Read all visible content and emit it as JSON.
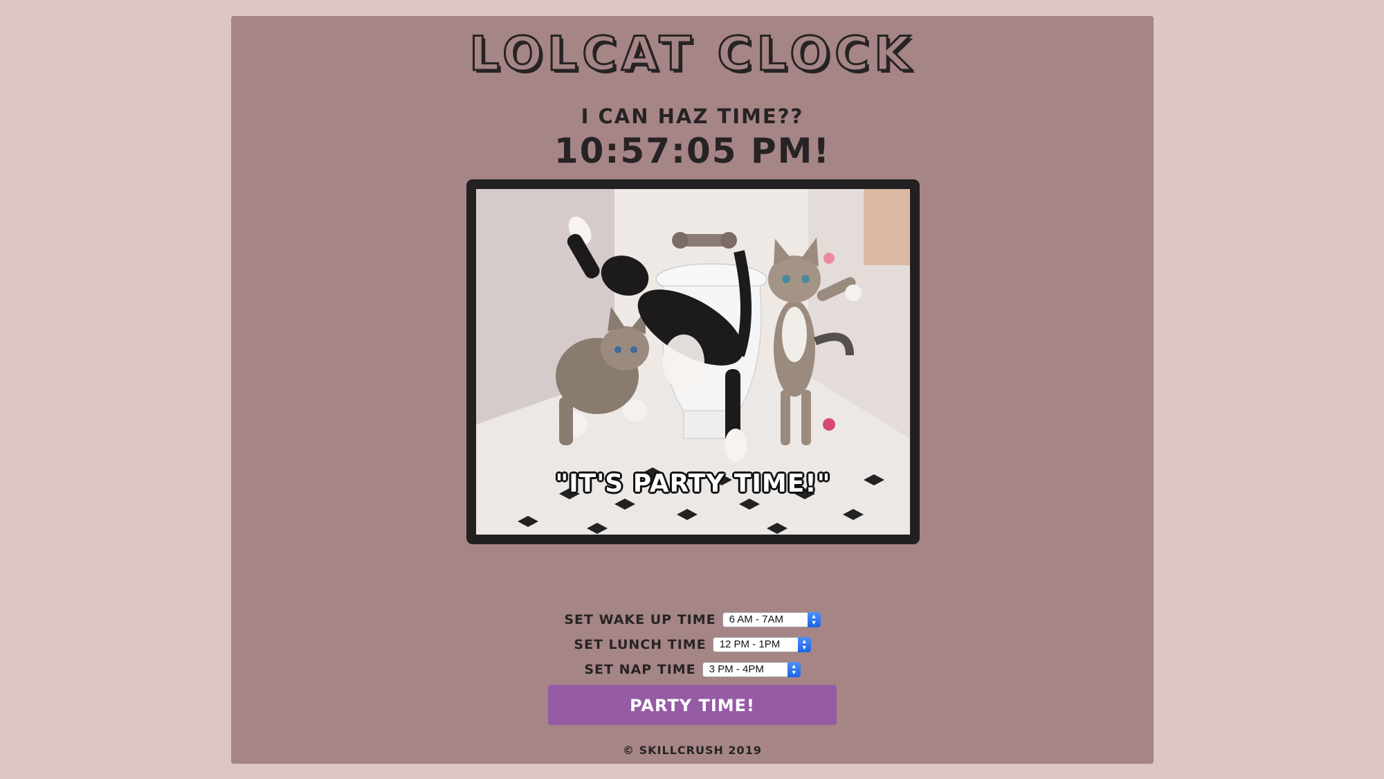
{
  "page": {
    "title": "Lolcat Clock",
    "subtitle": "I can haz time??",
    "clock_text": "10:57:05 PM!"
  },
  "photo": {
    "caption": "\"IT'S PARTY TIME!\"",
    "description": "three kittens dancing in a bathroom"
  },
  "settings": [
    {
      "label": "Set wake up time",
      "value": "6 AM - 7AM"
    },
    {
      "label": "Set lunch time",
      "value": "12 PM - 1PM"
    },
    {
      "label": "Set nap time",
      "value": "3 PM - 4PM"
    }
  ],
  "button": {
    "label": "Party Time!"
  },
  "footer": {
    "text": "© Skillcrush 2019"
  },
  "colors": {
    "page_bg": "#dfc6c6",
    "container_bg": "#a68586",
    "text": "#272324",
    "button": "#965ba5",
    "select_arrow": "#1b64e6"
  },
  "icons": {
    "select_arrow": "chevron-up-down-icon"
  }
}
